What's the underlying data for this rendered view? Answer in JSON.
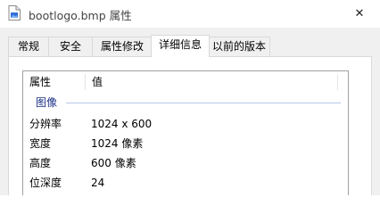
{
  "window": {
    "title": "bootlogo.bmp 属性",
    "close_glyph": "✕"
  },
  "tabs": [
    {
      "label": "常规",
      "active": false
    },
    {
      "label": "安全",
      "active": false
    },
    {
      "label": "属性修改",
      "active": false
    },
    {
      "label": "详细信息",
      "active": true
    },
    {
      "label": "以前的版本",
      "active": false
    }
  ],
  "details": {
    "columns": {
      "name": "属性",
      "value": "值"
    },
    "group": "图像",
    "rows": [
      {
        "name": "分辨率",
        "value": "1024 x 600"
      },
      {
        "name": "宽度",
        "value": "1024 像素"
      },
      {
        "name": "高度",
        "value": "600 像素"
      },
      {
        "name": "位深度",
        "value": "24"
      }
    ]
  },
  "icons": {
    "title_icon": "bmp-file-icon",
    "close": "close-icon"
  },
  "colors": {
    "group_label": "#1e3287",
    "group_line": "#b8c8e8",
    "icon_blue": "#2f6fd6"
  }
}
